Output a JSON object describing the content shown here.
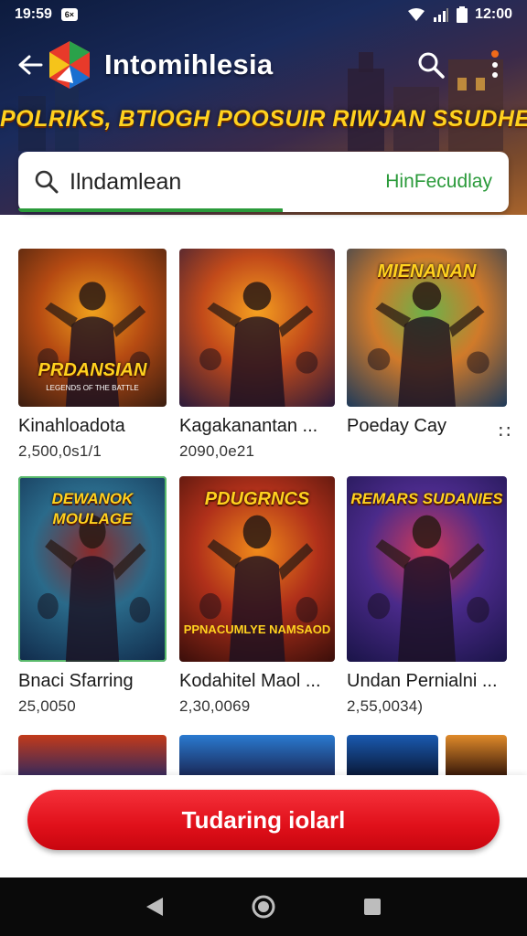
{
  "status_bar": {
    "time": "19:59",
    "badge": "6×",
    "clock": "12:00"
  },
  "header": {
    "title": "Intomihlesia",
    "banner": "POLRIKS, BTIOGH POOSUIR RIWJAN SSUDHES"
  },
  "search": {
    "query": "Ilndamlean",
    "filter_tab": "HinFecudlay",
    "progress_fraction": 0.54
  },
  "cards": [
    {
      "name": "Kinahloadota",
      "count": "2,500,0s1/1",
      "art_title": "PRDANSIAN",
      "art_sub": "LEGENDS OF THE BATTLE",
      "colors": [
        "#3a1d10",
        "#b54a12",
        "#f0a01c"
      ]
    },
    {
      "name": "Kagakanantan ...",
      "count": "2090,0e21",
      "art_title": "",
      "art_sub": "",
      "colors": [
        "#2a1a3a",
        "#c24a1a",
        "#f5a020"
      ]
    },
    {
      "name": "Poeday Cay",
      "count": "",
      "art_title": "MIENANAN",
      "art_sub": "",
      "colors": [
        "#1e3a5a",
        "#d07a2a",
        "#6bb24a"
      ]
    },
    {
      "name": "Bnaci Sfarring",
      "count": "25,0050",
      "art_title": "DEWANOK MOULAGE",
      "art_sub": "",
      "colors": [
        "#102a4a",
        "#2a6a8a",
        "#8a2a2a"
      ]
    },
    {
      "name": "Kodahitel Maol ...",
      "count": "2,30,0069",
      "art_title": "PDUGRNCS",
      "art_sub": "PPNACUMLYE NAMSAOD",
      "colors": [
        "#3a0e0a",
        "#b0301a",
        "#f08a1a"
      ]
    },
    {
      "name": "Undan Pernialni ...",
      "count": "2,55,0034)",
      "art_title": "REMARS SUDANIES",
      "art_sub": "",
      "colors": [
        "#1a1448",
        "#4a2a8a",
        "#d03a5a"
      ]
    }
  ],
  "cta_label": "Tudaring iolarl",
  "colors": {
    "accent_green": "#2a9a3a",
    "cta_red": "#e0101a",
    "banner_yellow": "#ffd21f"
  },
  "icons": [
    "back-arrow-icon",
    "app-logo-icon",
    "search-icon",
    "more-vert-icon",
    "wifi-icon",
    "signal-icon",
    "battery-icon",
    "nav-back-icon",
    "nav-home-icon",
    "nav-recents-icon",
    "more-dots-icon"
  ]
}
